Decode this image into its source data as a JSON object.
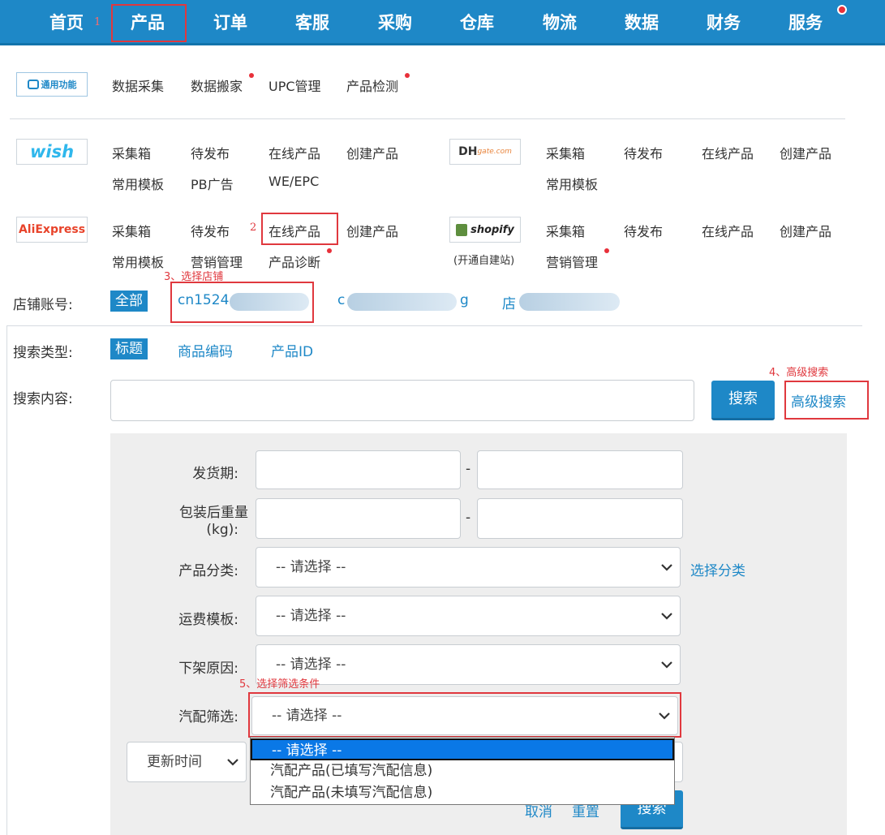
{
  "nav": {
    "items": [
      {
        "label": "首页"
      },
      {
        "label": "产品"
      },
      {
        "label": "订单"
      },
      {
        "label": "客服"
      },
      {
        "label": "采购"
      },
      {
        "label": "仓库"
      },
      {
        "label": "物流"
      },
      {
        "label": "数据"
      },
      {
        "label": "财务"
      },
      {
        "label": "服务"
      }
    ]
  },
  "annotations": {
    "n1": "1",
    "n2": "2",
    "n3": "3、选择店铺",
    "n4": "4、高级搜索",
    "n5": "5、选择筛选条件"
  },
  "general": {
    "badge": "通用功能",
    "links": [
      "数据采集",
      "数据搬家",
      "UPC管理",
      "产品检测"
    ]
  },
  "wish": {
    "logo": "wish",
    "links": [
      "采集箱",
      "待发布",
      "在线产品",
      "创建产品",
      "常用模板",
      "PB广告",
      "WE/EPC"
    ]
  },
  "dhgate": {
    "logo_dh": "DH",
    "logo_rest": "gate.com",
    "links": [
      "采集箱",
      "待发布",
      "在线产品",
      "创建产品",
      "常用模板"
    ]
  },
  "aliexpress": {
    "logo": "AliExpress",
    "links": [
      "采集箱",
      "待发布",
      "在线产品",
      "创建产品",
      "常用模板",
      "营销管理",
      "产品诊断"
    ]
  },
  "shopify": {
    "logo": "shopify",
    "sub": "(开通自建站)",
    "links": [
      "采集箱",
      "待发布",
      "在线产品",
      "创建产品",
      "营销管理"
    ]
  },
  "store": {
    "label": "店铺账号:",
    "all": "全部",
    "account1": "cn1524",
    "account2": "c",
    "account2_tail": "g",
    "account3": "店"
  },
  "search_type": {
    "label": "搜索类型:",
    "options": [
      "标题",
      "商品编码",
      "产品ID"
    ]
  },
  "search_content": {
    "label": "搜索内容:",
    "value": "",
    "button": "搜索",
    "advanced": "高级搜索"
  },
  "advanced": {
    "ship_label": "发货期:",
    "weight_label_1": "包装后重量",
    "weight_label_2": "(kg):",
    "dash": "-",
    "category_label": "产品分类:",
    "category_value": "-- 请选择 --",
    "category_link": "选择分类",
    "freight_label": "运费模板:",
    "freight_value": "-- 请选择 --",
    "offline_label": "下架原因:",
    "offline_value": "-- 请选择 --",
    "auto_label": "汽配筛选:",
    "auto_value": "-- 请选择 --",
    "sort_value": "更新时间",
    "cancel": "取消",
    "reset": "重置",
    "search": "搜索"
  },
  "dropdown": {
    "options": [
      "-- 请选择 --",
      "汽配产品(已填写汽配信息)",
      "汽配产品(未填写汽配信息)"
    ]
  },
  "colors": {
    "brand_blue": "#1e88c7",
    "annotation_red": "#e0383e",
    "dot_red": "#e8303a",
    "selected_option": "#0a78e6"
  }
}
